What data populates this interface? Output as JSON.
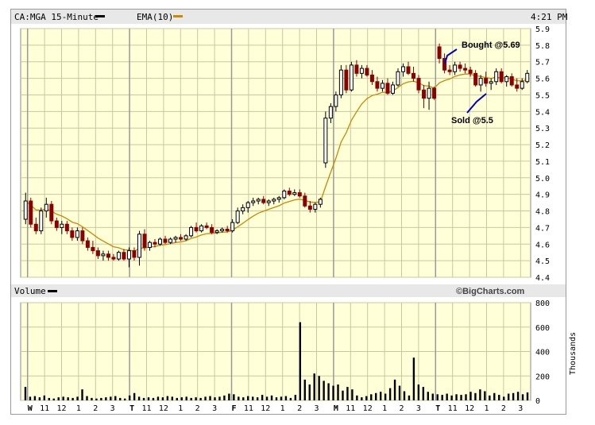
{
  "header": {
    "symbol_label": "CA:MGA 15-Minute",
    "ema_label": "EMA(10)",
    "time": "4:21 PM"
  },
  "volume_panel": {
    "label": "Volume",
    "brand": "©BigCharts.com",
    "unit_label": "Thousands"
  },
  "colors": {
    "plot_bg": "#ffffd8",
    "grid": "#c8c8a0",
    "up": "#000000",
    "down": "#8b0000",
    "ema": "#cc8800",
    "annotation_line": "#0000cc",
    "header_bg": "#e8e8e8"
  },
  "annotations": [
    {
      "text": "Bought @5.69"
    },
    {
      "text": "Sold @5.5"
    }
  ],
  "chart_data": [
    {
      "type": "candlestick",
      "title": "CA:MGA 15-Minute",
      "ylim": [
        4.4,
        5.9
      ],
      "y_ticks": [
        "5.9",
        "5.8",
        "5.7",
        "5.6",
        "5.5",
        "5.4",
        "5.3",
        "5.2",
        "5.1",
        "5.0",
        "4.9",
        "4.8",
        "4.7",
        "4.6",
        "4.5",
        "4.4"
      ],
      "x_ticks": [
        "W",
        "11",
        "12",
        "1",
        "2",
        "3",
        "T",
        "11",
        "12",
        "1",
        "2",
        "3",
        "F",
        "11",
        "12",
        "1",
        "2",
        "3",
        "M",
        "11",
        "12",
        "1",
        "2",
        "3",
        "T",
        "11",
        "12",
        "1",
        "2",
        "3"
      ],
      "day_labels": [
        "W",
        "T",
        "F",
        "M",
        "T"
      ],
      "grid": true,
      "series": [
        {
          "name": "CA:MGA 15-Minute",
          "ohlc": [
            [
              4.75,
              4.91,
              4.72,
              4.86
            ],
            [
              4.86,
              4.88,
              4.7,
              4.72
            ],
            [
              4.72,
              4.76,
              4.66,
              4.68
            ],
            [
              4.68,
              4.82,
              4.66,
              4.8
            ],
            [
              4.8,
              4.88,
              4.76,
              4.84
            ],
            [
              4.84,
              4.86,
              4.72,
              4.74
            ],
            [
              4.74,
              4.76,
              4.68,
              4.7
            ],
            [
              4.7,
              4.74,
              4.66,
              4.72
            ],
            [
              4.72,
              4.74,
              4.66,
              4.68
            ],
            [
              4.68,
              4.7,
              4.62,
              4.64
            ],
            [
              4.64,
              4.7,
              4.62,
              4.68
            ],
            [
              4.68,
              4.7,
              4.6,
              4.62
            ],
            [
              4.62,
              4.64,
              4.56,
              4.58
            ],
            [
              4.58,
              4.62,
              4.54,
              4.56
            ],
            [
              4.56,
              4.58,
              4.51,
              4.53
            ],
            [
              4.53,
              4.56,
              4.5,
              4.54
            ],
            [
              4.54,
              4.56,
              4.5,
              4.52
            ],
            [
              4.52,
              4.54,
              4.5,
              4.51
            ],
            [
              4.51,
              4.56,
              4.5,
              4.55
            ],
            [
              4.55,
              4.57,
              4.5,
              4.51
            ],
            [
              4.51,
              4.58,
              4.46,
              4.56
            ],
            [
              4.56,
              4.58,
              4.5,
              4.52
            ],
            [
              4.52,
              4.68,
              4.47,
              4.66
            ],
            [
              4.66,
              4.69,
              4.56,
              4.58
            ],
            [
              4.58,
              4.62,
              4.56,
              4.61
            ],
            [
              4.61,
              4.63,
              4.58,
              4.6
            ],
            [
              4.6,
              4.64,
              4.59,
              4.63
            ],
            [
              4.63,
              4.65,
              4.6,
              4.61
            ],
            [
              4.61,
              4.64,
              4.6,
              4.63
            ],
            [
              4.63,
              4.65,
              4.61,
              4.64
            ],
            [
              4.64,
              4.66,
              4.62,
              4.63
            ],
            [
              4.63,
              4.66,
              4.62,
              4.65
            ],
            [
              4.65,
              4.71,
              4.64,
              4.7
            ],
            [
              4.7,
              4.73,
              4.67,
              4.68
            ],
            [
              4.68,
              4.72,
              4.67,
              4.71
            ],
            [
              4.71,
              4.73,
              4.69,
              4.7
            ],
            [
              4.7,
              4.72,
              4.66,
              4.67
            ],
            [
              4.67,
              4.69,
              4.66,
              4.68
            ],
            [
              4.68,
              4.7,
              4.67,
              4.69
            ],
            [
              4.69,
              4.71,
              4.67,
              4.68
            ],
            [
              4.68,
              4.75,
              4.67,
              4.73
            ],
            [
              4.73,
              4.82,
              4.72,
              4.8
            ],
            [
              4.8,
              4.84,
              4.78,
              4.82
            ],
            [
              4.82,
              4.86,
              4.79,
              4.85
            ],
            [
              4.85,
              4.88,
              4.83,
              4.86
            ],
            [
              4.86,
              4.88,
              4.84,
              4.87
            ],
            [
              4.87,
              4.89,
              4.84,
              4.85
            ],
            [
              4.85,
              4.87,
              4.83,
              4.86
            ],
            [
              4.86,
              4.88,
              4.84,
              4.87
            ],
            [
              4.87,
              4.89,
              4.85,
              4.88
            ],
            [
              4.88,
              4.93,
              4.87,
              4.92
            ],
            [
              4.92,
              4.94,
              4.89,
              4.9
            ],
            [
              4.9,
              4.93,
              4.89,
              4.91
            ],
            [
              4.91,
              4.93,
              4.88,
              4.89
            ],
            [
              4.89,
              4.91,
              4.82,
              4.83
            ],
            [
              4.83,
              4.86,
              4.79,
              4.81
            ],
            [
              4.81,
              4.85,
              4.79,
              4.84
            ],
            [
              4.84,
              4.88,
              4.82,
              4.87
            ],
            [
              5.09,
              5.4,
              5.06,
              5.36
            ],
            [
              5.36,
              5.45,
              5.33,
              5.43
            ],
            [
              5.43,
              5.52,
              5.4,
              5.5
            ],
            [
              5.5,
              5.68,
              5.48,
              5.65
            ],
            [
              5.65,
              5.68,
              5.51,
              5.53
            ],
            [
              5.53,
              5.7,
              5.52,
              5.68
            ],
            [
              5.68,
              5.71,
              5.61,
              5.63
            ],
            [
              5.63,
              5.68,
              5.6,
              5.66
            ],
            [
              5.66,
              5.68,
              5.61,
              5.62
            ],
            [
              5.62,
              5.65,
              5.56,
              5.58
            ],
            [
              5.58,
              5.61,
              5.52,
              5.54
            ],
            [
              5.54,
              5.59,
              5.52,
              5.57
            ],
            [
              5.57,
              5.6,
              5.5,
              5.51
            ],
            [
              5.51,
              5.58,
              5.5,
              5.56
            ],
            [
              5.56,
              5.66,
              5.55,
              5.64
            ],
            [
              5.64,
              5.69,
              5.61,
              5.67
            ],
            [
              5.67,
              5.7,
              5.62,
              5.63
            ],
            [
              5.63,
              5.67,
              5.58,
              5.6
            ],
            [
              5.6,
              5.62,
              5.51,
              5.53
            ],
            [
              5.53,
              5.56,
              5.42,
              5.48
            ],
            [
              5.48,
              5.58,
              5.41,
              5.54
            ],
            [
              5.54,
              5.55,
              5.47,
              5.48
            ],
            [
              5.79,
              5.81,
              5.69,
              5.72
            ],
            [
              5.72,
              5.75,
              5.63,
              5.65
            ],
            [
              5.65,
              5.68,
              5.62,
              5.64
            ],
            [
              5.64,
              5.7,
              5.62,
              5.68
            ],
            [
              5.68,
              5.7,
              5.64,
              5.66
            ],
            [
              5.66,
              5.69,
              5.63,
              5.65
            ],
            [
              5.65,
              5.67,
              5.61,
              5.63
            ],
            [
              5.63,
              5.65,
              5.55,
              5.56
            ],
            [
              5.56,
              5.62,
              5.52,
              5.6
            ],
            [
              5.6,
              5.64,
              5.55,
              5.57
            ],
            [
              5.57,
              5.6,
              5.53,
              5.58
            ],
            [
              5.58,
              5.66,
              5.56,
              5.64
            ],
            [
              5.64,
              5.66,
              5.57,
              5.58
            ],
            [
              5.58,
              5.62,
              5.55,
              5.61
            ],
            [
              5.61,
              5.63,
              5.55,
              5.56
            ],
            [
              5.56,
              5.6,
              5.52,
              5.54
            ],
            [
              5.54,
              5.6,
              5.53,
              5.58
            ],
            [
              5.58,
              5.65,
              5.57,
              5.63
            ]
          ]
        },
        {
          "name": "EMA(10)"
        }
      ]
    },
    {
      "type": "bar",
      "title": "Volume",
      "ylabel": "Thousands",
      "ylim": [
        0,
        800
      ],
      "y_ticks": [
        "800",
        "600",
        "400",
        "200",
        "0"
      ],
      "series": [
        {
          "name": "Volume",
          "values": [
            110,
            30,
            35,
            25,
            40,
            20,
            15,
            25,
            30,
            25,
            20,
            30,
            90,
            35,
            20,
            15,
            20,
            25,
            30,
            35,
            20,
            15,
            40,
            60,
            30,
            20,
            25,
            20,
            30,
            25,
            35,
            30,
            20,
            25,
            30,
            20,
            25,
            20,
            30,
            35,
            25,
            30,
            40,
            55,
            50,
            30,
            25,
            35,
            30,
            25,
            45,
            30,
            40,
            25,
            30,
            35,
            20,
            45,
            640,
            170,
            130,
            220,
            200,
            160,
            140,
            120,
            130,
            80,
            110,
            90,
            40,
            25,
            35,
            50,
            60,
            70,
            55,
            100,
            170,
            120,
            75,
            40,
            350,
            130,
            110,
            70,
            55,
            50,
            45,
            55,
            40,
            50,
            45,
            50,
            70,
            60,
            90,
            75,
            40,
            60,
            45,
            30,
            55,
            60,
            70,
            50,
            65
          ]
        }
      ]
    }
  ]
}
